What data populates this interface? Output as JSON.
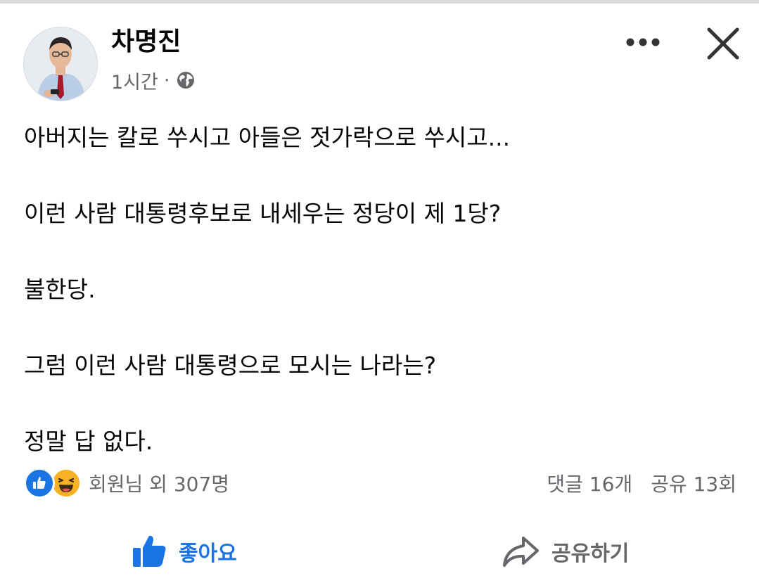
{
  "post": {
    "author": "차명진",
    "time": "1시간",
    "separator": "·",
    "privacy_icon": "globe-icon",
    "body_paragraphs": [
      "아버지는 칼로 쑤시고 아들은 젓가락으로 쑤시고...",
      "이런 사람 대통령후보로 내세우는 정당이 제 1당?",
      "불한당.",
      "그럼 이런 사람 대통령으로 모시는 나라는?",
      "정말 답 없다."
    ]
  },
  "header": {
    "more_icon": "more-options-icon",
    "close_icon": "close-icon"
  },
  "reactions": {
    "icons": [
      "like-reaction-icon",
      "haha-reaction-icon"
    ],
    "summary": "회원님 외 307명",
    "comments": "댓글 16개",
    "shares": "공유 13회"
  },
  "actions": {
    "like_label": "좋아요",
    "share_label": "공유하기"
  },
  "colors": {
    "accent": "#1b74e4",
    "secondary_text": "#65676b",
    "haha_yellow": "#f7b125"
  }
}
